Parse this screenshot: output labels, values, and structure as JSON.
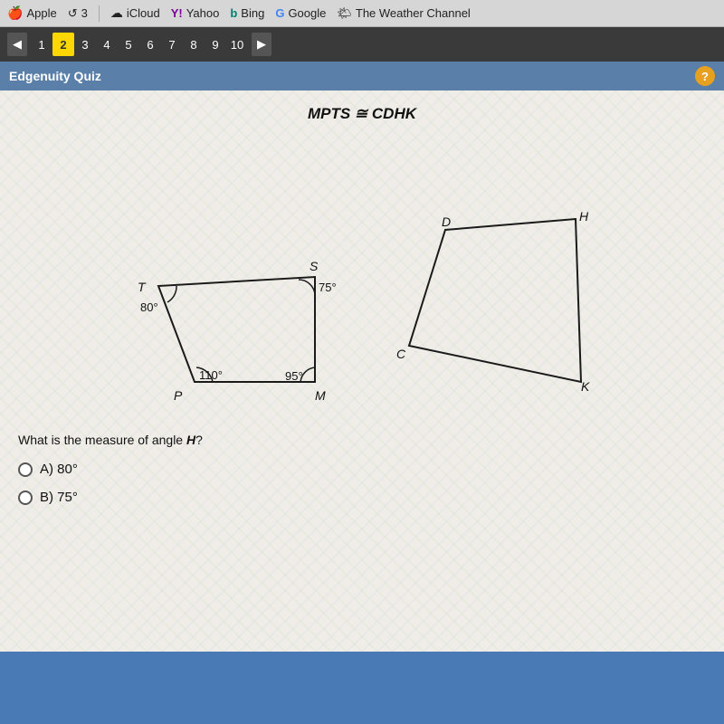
{
  "toolbar": {
    "items": [
      {
        "label": "Apple",
        "icon": "🍎",
        "name": "apple"
      },
      {
        "label": "3",
        "icon": "↺",
        "name": "refresh-count"
      },
      {
        "label": "iCloud",
        "icon": "☁",
        "name": "icloud"
      },
      {
        "label": "Yahoo",
        "icon": "Y!",
        "name": "yahoo"
      },
      {
        "label": "Bing",
        "icon": "b",
        "name": "bing"
      },
      {
        "label": "Google",
        "icon": "G",
        "name": "google"
      },
      {
        "label": "The Weather Channel",
        "icon": "🌤",
        "name": "weather-channel"
      }
    ]
  },
  "navigation": {
    "prev_label": "◀",
    "next_label": "▶",
    "pages": [
      "1",
      "2",
      "3",
      "4",
      "5",
      "6",
      "7",
      "8",
      "9",
      "10"
    ],
    "active_page": "2"
  },
  "quiz": {
    "title": "Edgenuity Quiz",
    "help_label": "?",
    "congruence_statement": "MPTS ≅ CDHK",
    "question": "What is the measure of angle H?",
    "angles": {
      "T": "80°",
      "S": "75°",
      "M": "95°",
      "P": "110°"
    },
    "shape_labels": {
      "left": [
        "T",
        "P",
        "M",
        "S"
      ],
      "right": [
        "C",
        "D",
        "H",
        "K"
      ]
    },
    "answers": [
      {
        "label": "A)  80°",
        "id": "A"
      },
      {
        "label": "B)  75°",
        "id": "B"
      }
    ]
  }
}
